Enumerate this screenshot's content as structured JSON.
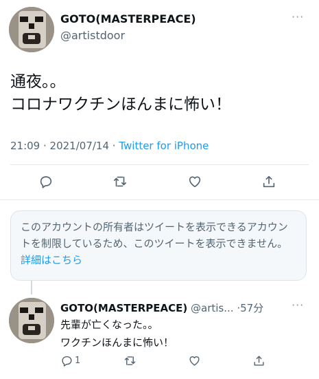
{
  "tweet": {
    "author_name": "GOTO(MASTERPEACE)",
    "author_handle": "@artistdoor",
    "more_label": "···",
    "text": "通夜。。\nコロナワクチンほんまに怖い！",
    "time": "21:09",
    "date": "2021/07/14",
    "separator": " · ",
    "source": "Twitter for iPhone",
    "icons": [
      "reply-icon",
      "retweet-icon",
      "like-icon",
      "share-icon"
    ]
  },
  "notice": {
    "text": "このアカウントの所有者はツイートを表示できるアカウントを制限しているため、このツイートを表示できません。",
    "link": "詳細はこちら"
  },
  "reply": {
    "author_name": "GOTO(MASTERPEACE)",
    "author_handle": "@artis...",
    "time": "·57分",
    "more_label": "···",
    "text": "先輩が亡くなった。。\nワクチンほんまに怖い！",
    "reply_count": "1",
    "icons": [
      "reply-icon",
      "retweet-icon",
      "like-icon",
      "share-icon"
    ]
  },
  "colors": {
    "link": "#1d9bf0",
    "secondary_text": "#536471",
    "notice_bg": "#f5f8fa"
  }
}
